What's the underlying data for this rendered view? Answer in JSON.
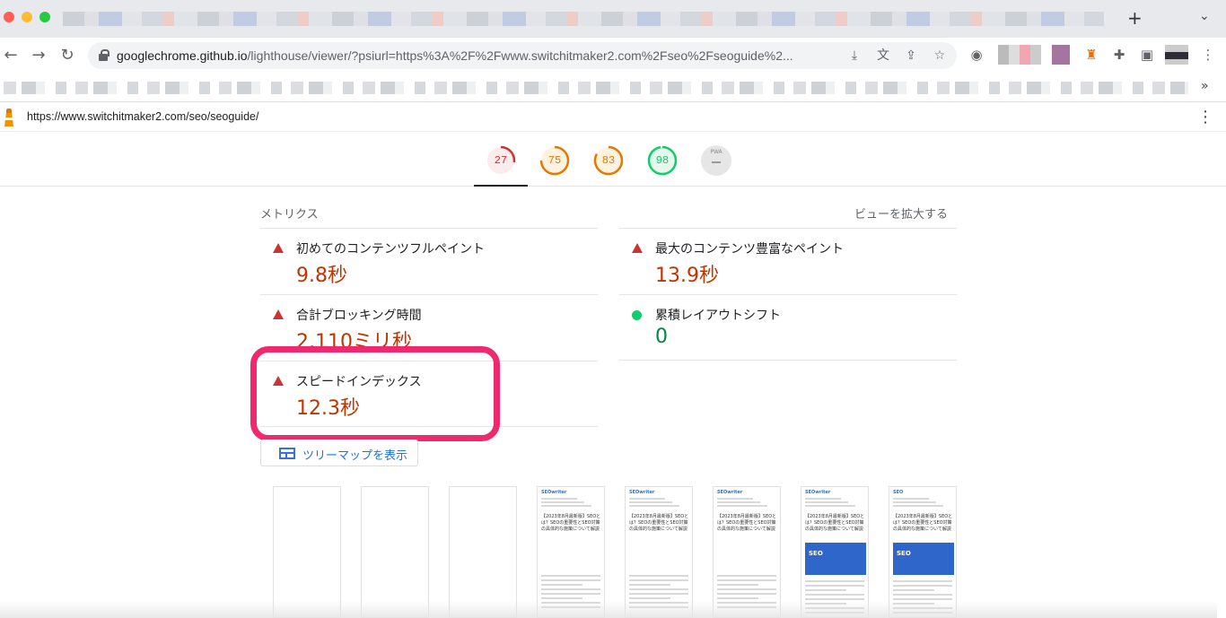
{
  "browser": {
    "url_host": "googlechrome.github.io",
    "url_path": "/lighthouse/viewer/?psiurl=https%3A%2F%2Fwww.switchitmaker2.com%2Fseo%2Fseoguide%2...",
    "icons": [
      "back-icon",
      "forward-icon",
      "reload-icon",
      "lock-icon",
      "download-icon",
      "translate-icon",
      "share-icon",
      "star-icon",
      "camera-icon",
      "extensions-icon",
      "sidepanel-icon",
      "kebab-icon"
    ]
  },
  "viewer": {
    "page_url": "https://www.switchitmaker2.com/seo/seoguide/"
  },
  "gauges": [
    {
      "label": "27",
      "score": 0.27,
      "color": "#cc3333",
      "bg": "#fcecec"
    },
    {
      "label": "75",
      "score": 0.75,
      "color": "#e67700",
      "bg": "#fff3e0"
    },
    {
      "label": "83",
      "score": 0.83,
      "color": "#e67700",
      "bg": "#fff3e0"
    },
    {
      "label": "98",
      "score": 0.98,
      "color": "#0cce6b",
      "bg": "#e6f7ec"
    }
  ],
  "pwa": {
    "label": "PWA"
  },
  "metrics": {
    "heading": "メトリクス",
    "expand_view": "ビューを拡大する",
    "items": [
      {
        "label": "初めてのコンテンツフルペイント",
        "value": "9.8秒",
        "status": "bad"
      },
      {
        "label": "最大のコンテンツ豊富なペイント",
        "value": "13.9秒",
        "status": "bad"
      },
      {
        "label": "合計ブロッキング時間",
        "value": "2,110ミリ秒",
        "status": "bad"
      },
      {
        "label": "累積レイアウトシフト",
        "value": "0",
        "status": "good"
      },
      {
        "label": "スピードインデックス",
        "value": "12.3秒",
        "status": "bad"
      }
    ]
  },
  "treemap": {
    "label": "ツリーマップを表示"
  },
  "filmstrip": {
    "frames": [
      {
        "header": "",
        "title": "",
        "image_text": ""
      },
      {
        "header": "",
        "title": "",
        "image_text": ""
      },
      {
        "header": "",
        "title": "",
        "image_text": ""
      },
      {
        "header": "SEOwriter",
        "title": "【2023年8月最新版】SEOとは？SEOの重要性とSEO対策の具体的な施策について解説",
        "image_text": ""
      },
      {
        "header": "SEOwriter",
        "title": "【2023年8月最新版】SEOとは？SEOの重要性とSEO対策の具体的な施策について解説",
        "image_text": ""
      },
      {
        "header": "SEOwriter",
        "title": "【2023年8月最新版】SEOとは？SEOの重要性とSEO対策の具体的な施策について解説",
        "image_text": ""
      },
      {
        "header": "SEOwriter",
        "title": "【2023年8月最新版】SEOとは？SEOの重要性とSEO対策の具体的な施策について解説",
        "image_text": "SEO"
      },
      {
        "header": "SEO",
        "title": "【2023年8月最新版】SEOとは？SEOの重要性とSEO対策の具体的な施策について解説",
        "image_text": "SEO"
      }
    ]
  }
}
